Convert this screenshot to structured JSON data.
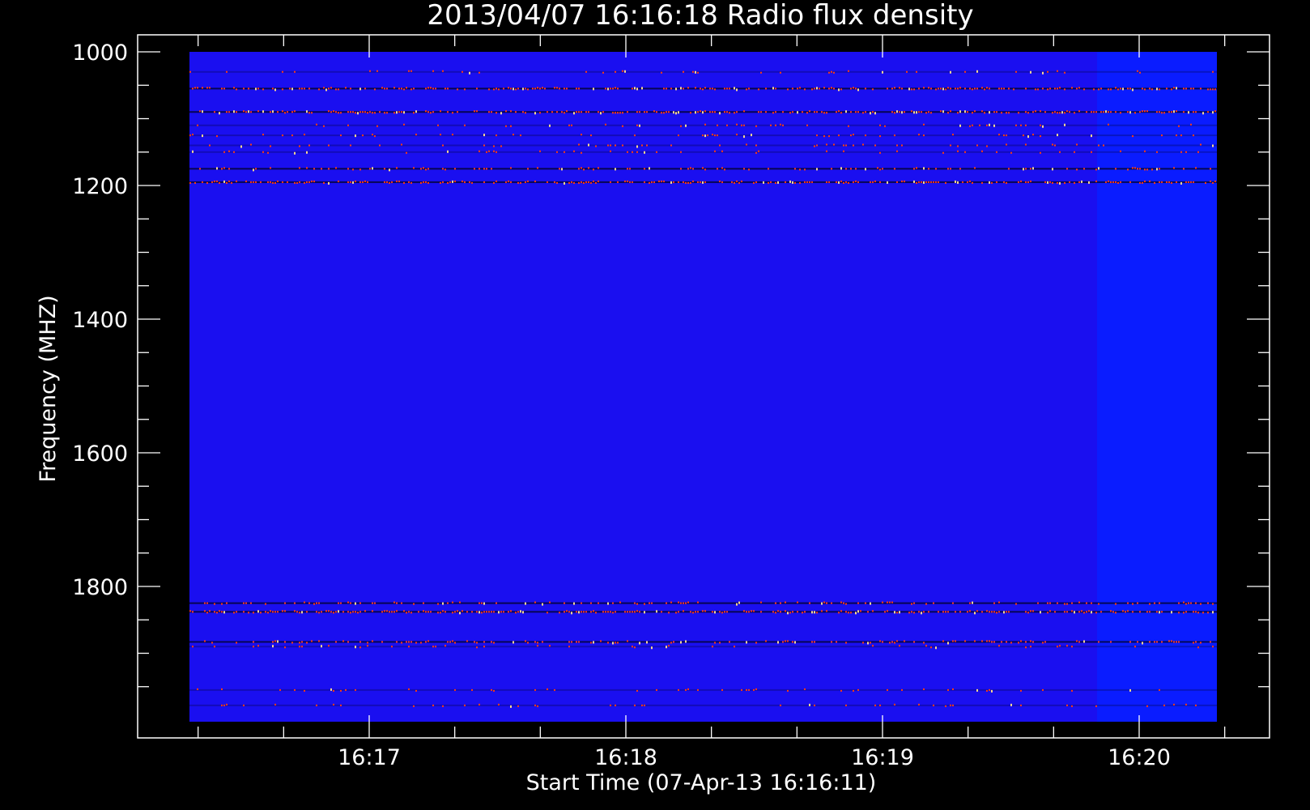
{
  "chart_data": {
    "type": "heatmap",
    "title": "2013/04/07 16:16:18 Radio flux density",
    "xlabel": "Start Time (07-Apr-13 16:16:11)",
    "ylabel": "Frequency (MHZ)",
    "x_tick_labels": [
      "16:17",
      "16:18",
      "16:19",
      "16:20"
    ],
    "y_tick_labels": [
      "1000",
      "1200",
      "1400",
      "1600",
      "1800"
    ],
    "y_major_values_mhz": [
      1000,
      1200,
      1400,
      1600,
      1800
    ],
    "x_major_values": [
      "16:17",
      "16:18",
      "16:19",
      "16:20"
    ],
    "ylim_mhz": [
      975,
      2000
    ],
    "y_inverted": true,
    "data_frequency_range_mhz": [
      1000,
      2000
    ],
    "colors": {
      "background_flux": "#1a0ff0",
      "late_segment_flux": "#0a1cff",
      "high_flux": "#ff3b10",
      "peak_flux": "#ffd890",
      "dark": "#000010"
    },
    "bright_bands": [
      {
        "freq_mhz": 1030,
        "strength": "weak"
      },
      {
        "freq_mhz": 1055,
        "strength": "strong"
      },
      {
        "freq_mhz": 1090,
        "strength": "strong"
      },
      {
        "freq_mhz": 1110,
        "strength": "weak"
      },
      {
        "freq_mhz": 1125,
        "strength": "weak"
      },
      {
        "freq_mhz": 1140,
        "strength": "weak"
      },
      {
        "freq_mhz": 1150,
        "strength": "weak"
      },
      {
        "freq_mhz": 1175,
        "strength": "medium"
      },
      {
        "freq_mhz": 1195,
        "strength": "strong"
      },
      {
        "freq_mhz": 1825,
        "strength": "medium"
      },
      {
        "freq_mhz": 1838,
        "strength": "strong"
      },
      {
        "freq_mhz": 1883,
        "strength": "medium"
      },
      {
        "freq_mhz": 1890,
        "strength": "weak"
      },
      {
        "freq_mhz": 1955,
        "strength": "weak"
      },
      {
        "freq_mhz": 1978,
        "strength": "weak"
      }
    ]
  }
}
